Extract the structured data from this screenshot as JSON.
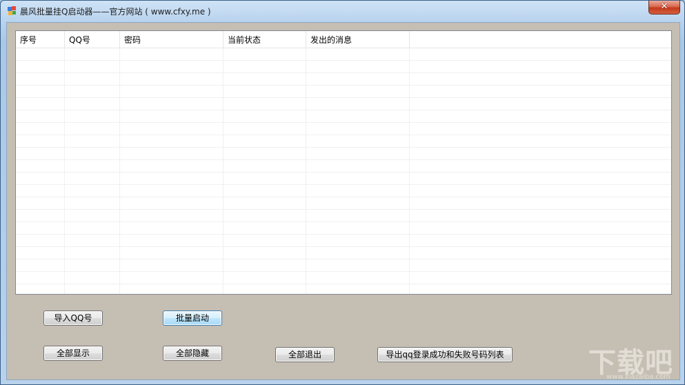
{
  "window": {
    "title": "晨风批量挂Q启动器——官方网站 ( www.cfxy.me )",
    "close_glyph": "✕"
  },
  "grid": {
    "columns": [
      "序号",
      "QQ号",
      "密码",
      "当前状态",
      "发出的消息"
    ]
  },
  "buttons": {
    "import_qq": "导入QQ号",
    "batch_start": "批量启动",
    "show_all": "全部显示",
    "hide_all": "全部隐藏",
    "exit_all": "全部退出",
    "export_list": "导出qq登录成功和失败号码列表"
  },
  "watermark": {
    "big": "下载吧",
    "small": "www.xiazaiba.com"
  },
  "colors": {
    "client_bg": "#c5beb3",
    "title_gradient_top": "#cfe3f6",
    "close_red": "#c3391d"
  },
  "icons": [
    "app-icon",
    "close-icon"
  ]
}
